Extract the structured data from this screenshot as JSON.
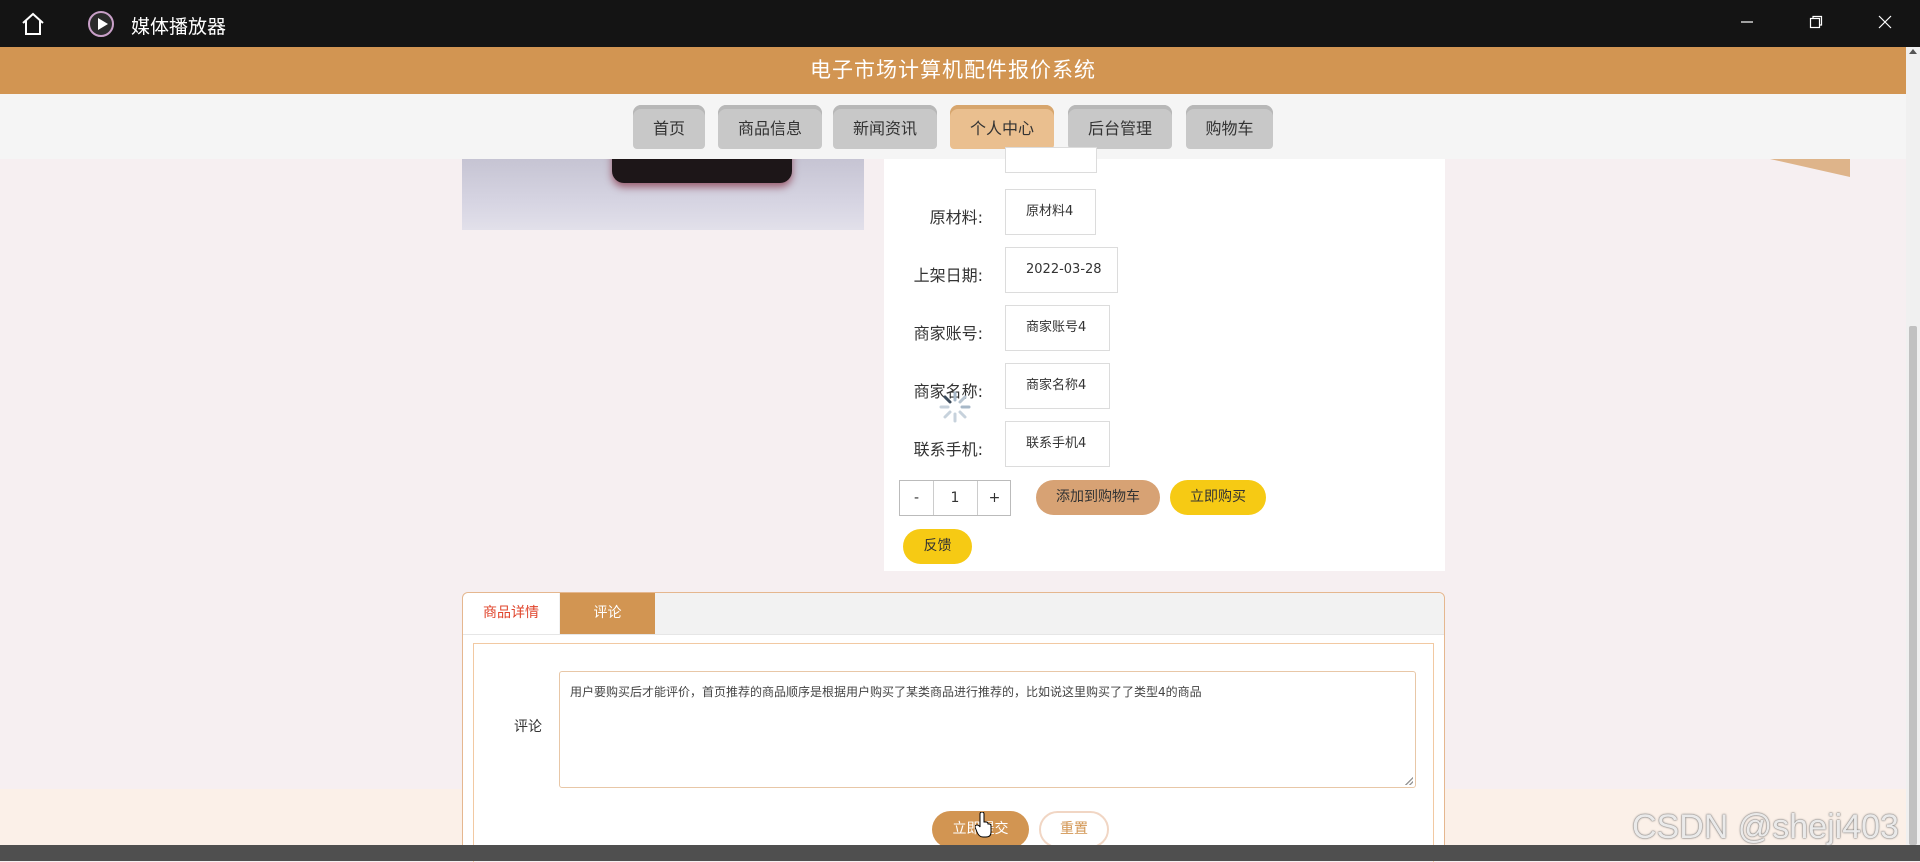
{
  "window": {
    "title": "媒体播放器",
    "home_icon": "home-icon",
    "app_icon": "media-player-icon"
  },
  "site": {
    "title": "电子市场计算机配件报价系统"
  },
  "nav": {
    "items": [
      {
        "label": "首页"
      },
      {
        "label": "商品信息"
      },
      {
        "label": "新闻资讯"
      },
      {
        "label": "个人中心",
        "active": true
      },
      {
        "label": "后台管理"
      },
      {
        "label": "购物车"
      }
    ]
  },
  "product": {
    "fields": [
      {
        "label": "原材料:",
        "value": "原材料4"
      },
      {
        "label": "上架日期:",
        "value": "2022-03-28"
      },
      {
        "label": "商家账号:",
        "value": "商家账号4"
      },
      {
        "label": "商家名称:",
        "value": "商家名称4"
      },
      {
        "label": "联系手机:",
        "value": "联系手机4"
      }
    ],
    "quantity": {
      "minus": "-",
      "value": "1",
      "plus": "+"
    },
    "add_to_cart": "添加到购物车",
    "buy_now": "立即购买",
    "feedback": "反馈"
  },
  "tabs": {
    "detail": "商品详情",
    "comment": "评论"
  },
  "comment_form": {
    "label": "评论",
    "text": "用户要购买后才能评价，首页推荐的商品顺序是根据用户购买了某类商品进行推荐的，比如说这里购买了了类型4的商品",
    "submit": "立即提交",
    "reset": "重置"
  },
  "watermark": "CSDN @sheji403",
  "colors": {
    "header": "#d29552",
    "nav_active": "#eabf8f",
    "button_yellow": "#f6ca14",
    "button_brown": "#d7a274",
    "tab_active_text": "#e0442b"
  }
}
